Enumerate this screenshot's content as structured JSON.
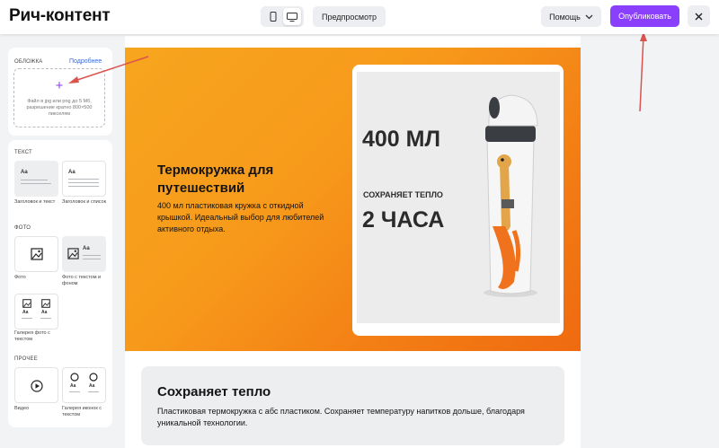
{
  "header": {
    "title": "Рич-контент",
    "preview_label": "Предпросмотр",
    "help_label": "Помощь",
    "publish_label": "Опубликовать",
    "accent_color": "#8a3ffc"
  },
  "sidebar": {
    "cover": {
      "label": "ОБЛОЖКА",
      "more_link": "Подробнее",
      "upload_hint": "Файл в jpg или png до 5 Мб, разрешение кратно 800×500 пикселям"
    },
    "sections": {
      "text": "ТЕКСТ",
      "photo": "ФОТО",
      "other": "ПРОЧЕЕ"
    },
    "tiles": {
      "heading_text": "Заголовок и текст",
      "heading_list": "Заголовок и список",
      "photo": "Фото",
      "photo_text_bg": "Фото с текстом и фоном",
      "gallery_photo_text": "Галерея фото с текстом",
      "video": "Видео",
      "gallery_icons_text": "Галерея иконок с текстом",
      "aa": "Аа"
    }
  },
  "canvas": {
    "hero": {
      "title": "Термокружка для путешествий",
      "text": "400 мл пластиковая кружка с откидной крышкой. Идеальный выбор для любителей активного отдыха.",
      "image_volume": "400 МЛ",
      "image_caption": "СОХРАНЯЕТ ТЕПЛО",
      "image_hours": "2 ЧАСА"
    },
    "block2": {
      "title": "Сохраняет тепло",
      "text": "Пластиковая термокружка с абс пластиком. Сохраняет температуру напитков дольше, благодаря уникальной технологии."
    }
  },
  "icons": [
    "phone-icon",
    "desktop-icon",
    "chevron-down-icon",
    "close-icon",
    "plus-icon",
    "image-icon",
    "play-icon",
    "circle-icon"
  ]
}
